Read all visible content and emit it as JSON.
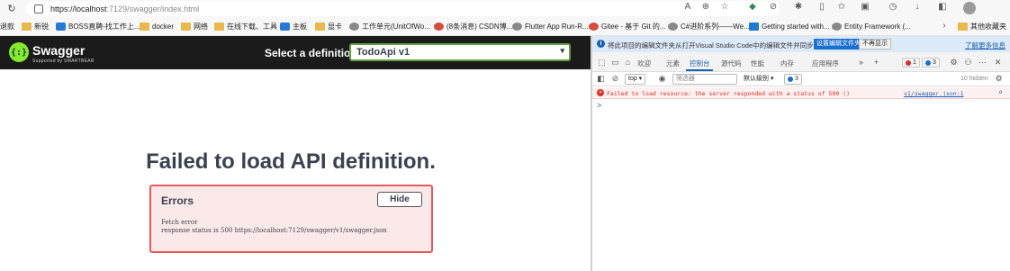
{
  "browser": {
    "url_prefix": "https://localhost",
    "url_rest": ":7129/swagger/index.html",
    "bookmarks": [
      "退款",
      "新锐",
      "BOSS直聘-找工作上...",
      "docker",
      "网络",
      "在线下载、工具",
      "主板",
      "显卡",
      "工作单元(UnitOfWo...",
      "(8条消息) CSDN博...",
      "Flutter App Run-R...",
      "Gitee - 基于 Git 的...",
      "C#进阶系列——We...",
      "Getting started with...",
      "Entity Framework (...",
      "其他收藏夹"
    ]
  },
  "swagger": {
    "logo_text": "{:}",
    "name": "Swagger",
    "sub": "Supported by SMARTBEAR",
    "select_label": "Select a definition",
    "selected_definition": "TodoApi v1",
    "fail_title": "Failed to load API definition.",
    "errors_title": "Errors",
    "hide_label": "Hide",
    "error_line1": "Fetch error",
    "error_line2": "response status is 500 https://localhost:7129/swagger/v1/swagger.json"
  },
  "devtools": {
    "info_message": "将此项目的编辑文件夹从打开Visual Studio Code中的编辑文件并同步更改。",
    "info_button1": "设置编辑文件夹",
    "info_button2": "不再显示",
    "info_more": "了解更多信息",
    "tabs": [
      "欢迎",
      "元素",
      "控制台",
      "源代码",
      "性能",
      "内存",
      "应用程序"
    ],
    "active_tab": "控制台",
    "error_count": "1",
    "issue_count": "3",
    "context": "top",
    "filter_placeholder": "筛选器",
    "level": "默认级别",
    "issues_badge": "3",
    "hidden_text": "10 hidden",
    "console_error": "Failed to load resource: the server responded with a status of 500 ()",
    "console_error_source": "v1/swagger.json:1",
    "prompt": ">"
  },
  "colors": {
    "swagger_green": "#85ea2d",
    "swagger_topbar": "#1b1b1b",
    "error_red": "#d93025",
    "devtools_blue": "#1a5fb4"
  }
}
